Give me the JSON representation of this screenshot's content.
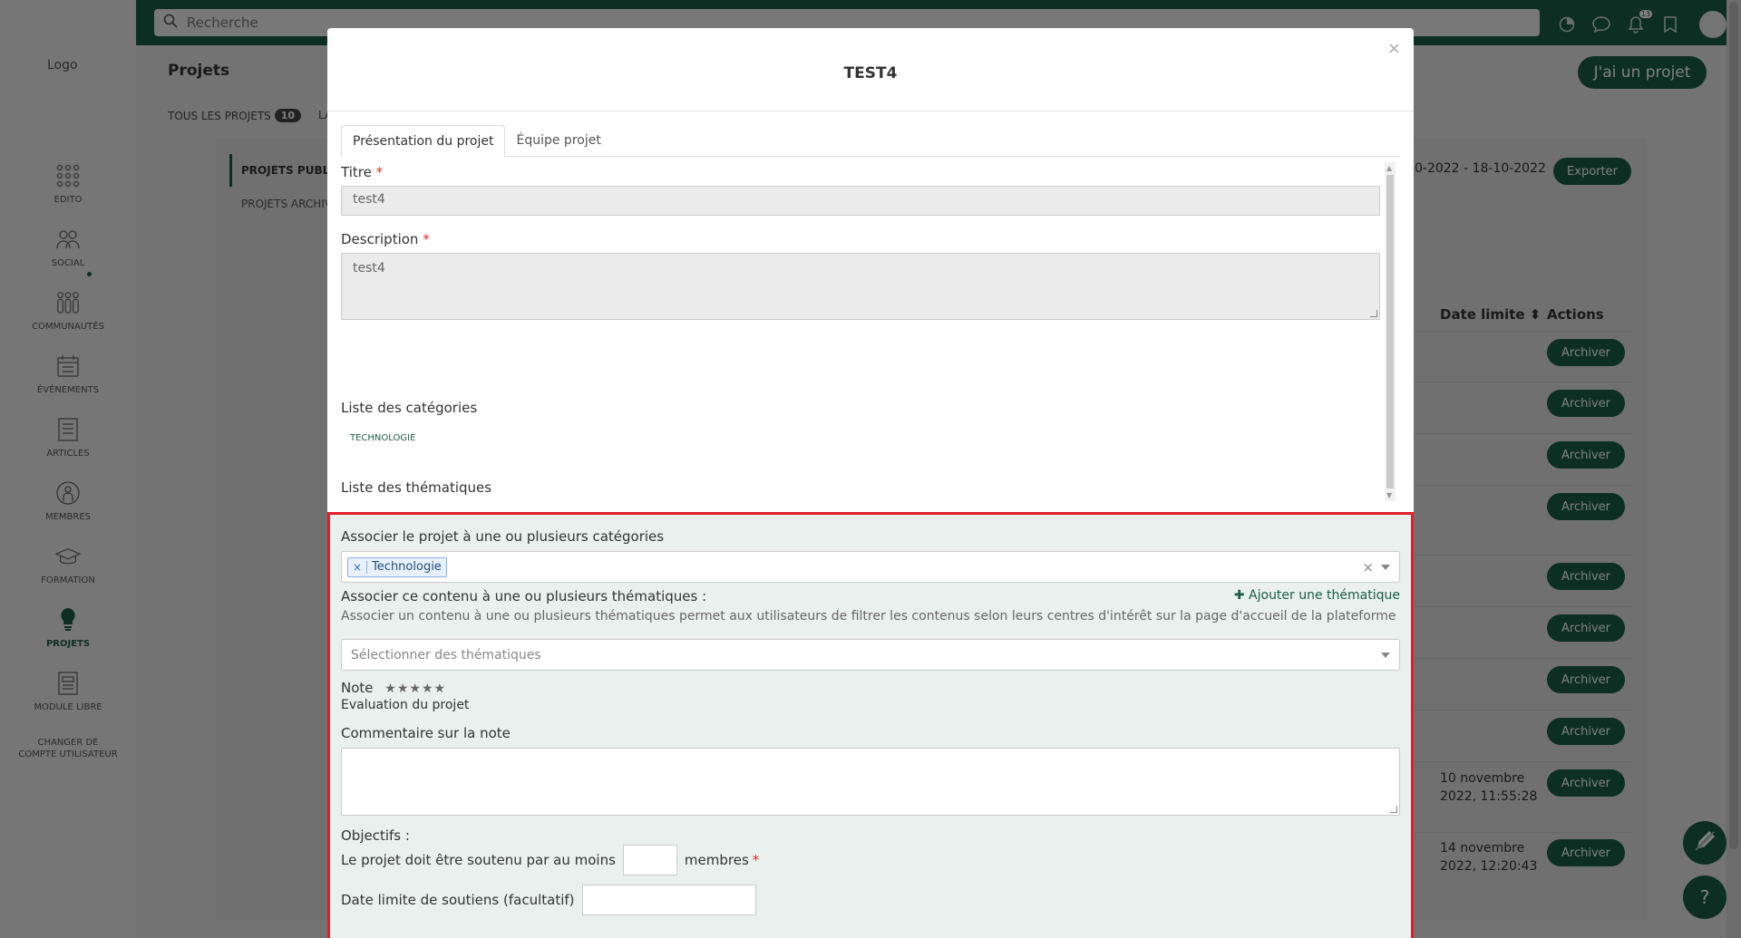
{
  "sidebar": {
    "logo_alt": "Logo",
    "items": [
      {
        "label": "EDITO",
        "icon": "grid-dots-icon"
      },
      {
        "label": "SOCIAL",
        "icon": "people-icon"
      },
      {
        "label": "COMMUNAUTÉS",
        "icon": "community-icon"
      },
      {
        "label": "ÉVÉNEMENTS",
        "icon": "calendar-icon"
      },
      {
        "label": "ARTICLES",
        "icon": "article-icon"
      },
      {
        "label": "MEMBRES",
        "icon": "member-icon"
      },
      {
        "label": "FORMATION",
        "icon": "graduation-cap-icon"
      },
      {
        "label": "PROJETS",
        "icon": "lightbulb-icon"
      },
      {
        "label": "MODULE LIBRE",
        "icon": "document-icon"
      }
    ],
    "switch_account": "CHANGER DE COMPTE UTILISATEUR"
  },
  "topbar": {
    "search_placeholder": "Recherche",
    "notif_count": "13"
  },
  "page": {
    "title": "Projets",
    "new_project_button": "J'ai un projet",
    "tab_all": "TOUS LES PROJETS",
    "tab_all_count": "10",
    "tab_la": "LA",
    "side_published": "PROJETS PUBLIÉS",
    "side_archived": "PROJETS ARCHIVÉS",
    "date_range": "0-2022 - 18-10-2022",
    "export_button": "Exporter",
    "col_deadline": "Date limite ⬍",
    "col_actions": "Actions",
    "archive_label": "Archiver",
    "row_dates": [
      "10 novembre 2022, 11:55:28",
      "14 novembre 2022, 12:20:43"
    ]
  },
  "modal": {
    "title": "TEST4",
    "close": "×",
    "tabs": [
      "Présentation du projet",
      "Équipe projet"
    ],
    "title_label": "Titre",
    "title_value": "test4",
    "description_label": "Description",
    "description_value": "test4",
    "categories_list_label": "Liste des catégories",
    "category_chip": "TECHNOLOGIE",
    "themes_list_label": "Liste des thématiques",
    "assoc_categories_label": "Associer le projet à une ou plusieurs catégories",
    "selected_category": "Technologie",
    "assoc_themes_label": "Associer ce contenu à une ou plusieurs thématiques :",
    "add_theme_link": "Ajouter une thématique",
    "themes_help": "Associer un contenu à une ou plusieurs thématiques permet aux utilisateurs de filtrer les contenus selon leurs centres d'intérêt sur la page d'accueil de la plateforme",
    "themes_placeholder": "Sélectionner des thématiques",
    "note_label": "Note",
    "note_stars": "★★★★★",
    "note_help": "Evaluation du projet",
    "comment_label": "Commentaire sur la note",
    "objectives_label": "Objectifs :",
    "support_prefix": "Le projet doit être soutenu par au moins",
    "support_suffix": "membres",
    "deadline_label": "Date limite de soutiens (facultatif)"
  },
  "colors": {
    "brand": "#1b5e46",
    "highlight_border": "#e0202a",
    "required": "#d9302c"
  }
}
